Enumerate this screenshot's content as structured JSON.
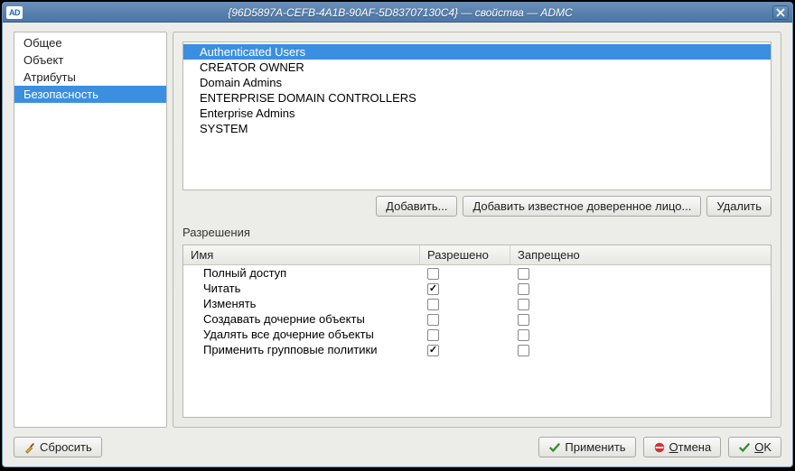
{
  "title": "{96D5897A-CEFB-4A1B-90AF-5D83707130C4} — свойства — ADMC",
  "app_icon_text": "AD",
  "sidebar": {
    "items": [
      {
        "label": "Общее",
        "selected": false
      },
      {
        "label": "Объект",
        "selected": false
      },
      {
        "label": "Атрибуты",
        "selected": false
      },
      {
        "label": "Безопасность",
        "selected": true
      }
    ]
  },
  "principals": [
    {
      "label": "Authenticated Users",
      "selected": true
    },
    {
      "label": "CREATOR OWNER",
      "selected": false
    },
    {
      "label": "Domain Admins",
      "selected": false
    },
    {
      "label": "ENTERPRISE DOMAIN CONTROLLERS",
      "selected": false
    },
    {
      "label": "Enterprise Admins",
      "selected": false
    },
    {
      "label": "SYSTEM",
      "selected": false
    }
  ],
  "buttons": {
    "add": "Добавить...",
    "add_trusted": "Добавить известное доверенное лицо...",
    "remove": "Удалить",
    "reset": "Сбросить",
    "apply": "Применить",
    "cancel": "Отмена",
    "ok": "OK"
  },
  "section_label": "Разрешения",
  "table": {
    "headers": {
      "name": "Имя",
      "allow": "Разрешено",
      "deny": "Запрещено"
    },
    "rows": [
      {
        "name": "Полный доступ",
        "allow": false,
        "deny": false
      },
      {
        "name": "Читать",
        "allow": true,
        "deny": false
      },
      {
        "name": "Изменять",
        "allow": false,
        "deny": false
      },
      {
        "name": "Создавать дочерние объекты",
        "allow": false,
        "deny": false
      },
      {
        "name": "Удалять все дочерние объекты",
        "allow": false,
        "deny": false
      },
      {
        "name": "Применить групповые политики",
        "allow": true,
        "deny": false
      }
    ]
  }
}
